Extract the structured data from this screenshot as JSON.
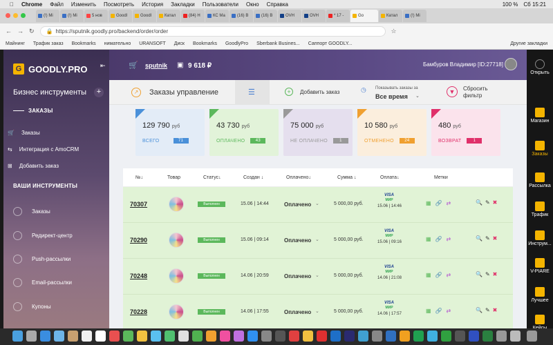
{
  "macbar": {
    "apple": "",
    "app": "Chrome",
    "menus": [
      "Файл",
      "Изменить",
      "Посмотреть",
      "История",
      "Закладки",
      "Пользователи",
      "Окно",
      "Справка"
    ],
    "battery": "100 %",
    "clock": "Сб 15:21"
  },
  "tabs": [
    "(!) Mi",
    "(!) Mi",
    "5 нов",
    "Goodl",
    "Goodl",
    "Катал",
    "(84) H",
    "КС Ма",
    "(16) B",
    "(16) B",
    "OVH",
    "OVH",
    "* 17 -",
    "Go",
    "Катал",
    "(!) Mi"
  ],
  "address": {
    "url": "https://sputnik.goodly.pro/backend/order/order"
  },
  "bookmarks": [
    "Майнинг",
    "Трафик заказ",
    "Bookmarks",
    "нимательно",
    "URANSOFT",
    "Диск",
    "Bookmarks",
    "GoodlyPro",
    "Sberbank Busines...",
    "Саппорт GOODLY..."
  ],
  "bookmarks_other": "Другие закладки",
  "sidebar": {
    "logo": "GOODLY.PRO",
    "biz_title": "Бизнес инструменты",
    "orders_section": "ЗАКАЗЫ",
    "items": [
      "Заказы",
      "Интеграция с AmoCRM",
      "Добавить заказ"
    ],
    "tools_section": "ВАШИ ИНСТРУМЕНТЫ",
    "tools": [
      "Заказы",
      "Редирект-центр",
      "Push-рассылки",
      "Email-рассылки",
      "Купоны"
    ]
  },
  "header": {
    "shop": "sputnik",
    "balance": "9 618 ₽",
    "user": "Бамбуров Владимир [ID:27718]"
  },
  "toolbar": {
    "title": "Заказы управление",
    "add": "Добавить заказ",
    "show_label": "Показывать заказы за",
    "period": "Все время",
    "reset1": "Сбросить",
    "reset2": "фильтр"
  },
  "cards": [
    {
      "amount": "129 790",
      "unit": "руб",
      "label": "ВСЕГО",
      "count": "71",
      "color": "#4a90d9",
      "bg": "#e3ecf7"
    },
    {
      "amount": "43 730",
      "unit": "руб",
      "label": "ОПЛАЧЕНО",
      "count": "43",
      "color": "#5cb85c",
      "bg": "#e2f3d9"
    },
    {
      "amount": "75 000",
      "unit": "руб",
      "label": "НЕ ОПЛАЧЕНО",
      "count": "1",
      "color": "#999999",
      "bg": "#e5dfee"
    },
    {
      "amount": "10 580",
      "unit": "руб",
      "label": "ОТМЕНЕНО",
      "count": "24",
      "color": "#f0a030",
      "bg": "#fbeedd"
    },
    {
      "amount": "480",
      "unit": "руб",
      "label": "ВОЗВРАТ",
      "count": "1",
      "color": "#e0306a",
      "bg": "#fbe3ec"
    }
  ],
  "table_headers": [
    "№↓",
    "Товар",
    "Статус↓",
    "Создан ↓",
    "Оплачено↓",
    "Сумма ↓",
    "Оплата↓",
    "Метки"
  ],
  "rows": [
    {
      "id": "70307",
      "status": "Выполнен",
      "created": "15.06 | 14:44",
      "paid": "Оплачено",
      "sum": "5 000,00 руб.",
      "visa": "VISA",
      "mir": "МИР",
      "pay_date": "15.06 | 14:46"
    },
    {
      "id": "70290",
      "status": "Выполнен",
      "created": "15.06 | 09:14",
      "paid": "Оплачено",
      "sum": "5 000,00 руб.",
      "visa": "VISA",
      "mir": "МИР",
      "pay_date": "15.06 | 09:16"
    },
    {
      "id": "70248",
      "status": "Выполнен",
      "created": "14.06 | 20:59",
      "paid": "Оплачено",
      "sum": "5 000,00 руб.",
      "visa": "VISA",
      "mir": "МИР",
      "pay_date": "14.06 | 21:08"
    },
    {
      "id": "70228",
      "status": "Выполнен",
      "created": "14.06 | 17:55",
      "paid": "Оплачено",
      "sum": "5 000,00 руб.",
      "visa": "VISA",
      "mir": "МИР",
      "pay_date": "14.06 | 17:57"
    }
  ],
  "rdock": [
    {
      "label": "Открыть"
    },
    {
      "label": "Магазин"
    },
    {
      "label": "Заказы"
    },
    {
      "label": "Рассылка"
    },
    {
      "label": "Трафик"
    },
    {
      "label": "Инструм..."
    },
    {
      "label": "V-PIARE"
    },
    {
      "label": "Лучшее"
    },
    {
      "label": "Кейсы"
    }
  ]
}
